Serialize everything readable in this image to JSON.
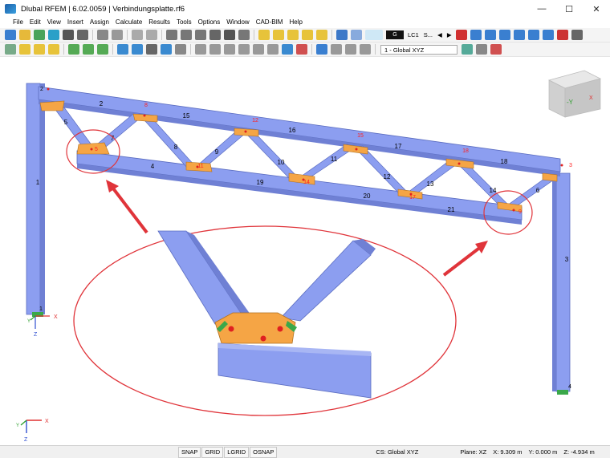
{
  "window": {
    "title": "Dlubal RFEM | 6.02.0059 | Verbindungsplatte.rf6",
    "minimize_symbol": "—",
    "maximize_symbol": "☐",
    "close_symbol": "✕"
  },
  "menu": [
    "File",
    "Edit",
    "View",
    "Insert",
    "Assign",
    "Calculate",
    "Results",
    "Tools",
    "Options",
    "Window",
    "CAD-BIM",
    "Help"
  ],
  "toolbar": {
    "lc_g": "G",
    "lc_label": "LC1",
    "lc_sub": "S...",
    "cs_combo": "1 - Global XYZ"
  },
  "model": {
    "members": {
      "m1": "1",
      "m2": "2",
      "m3": "3",
      "m4": "4",
      "m5": "5",
      "m6": "6",
      "m7": "7",
      "m8": "8",
      "m9": "9",
      "m10": "10",
      "m11": "11",
      "m12": "12",
      "m13": "13",
      "m14": "14",
      "m15": "15",
      "m16": "16",
      "m17": "17",
      "m18": "18",
      "m19": "19",
      "m20": "20",
      "m21": "21"
    },
    "plates": {
      "p3": "3",
      "p5": "5",
      "p8": "8",
      "p11": "11",
      "p12": "12",
      "p14": "14",
      "p15": "15",
      "p17": "17",
      "p18": "18",
      "p9": "9"
    },
    "nodes": {
      "n1": "1",
      "n2": "2",
      "n4": "4",
      "n3": "3"
    },
    "axes": {
      "x": "X",
      "y": "Y",
      "z": "Z"
    },
    "nav_cube_face": "-Y"
  },
  "statusbar": {
    "snap": "SNAP",
    "grid": "GRID",
    "lgrid": "LGRID",
    "osnap": "OSNAP",
    "cs": "CS: Global XYZ",
    "plane": "Plane: XZ",
    "x": "X: 9.309 m",
    "y": "Y: 0.000 m",
    "z": "Z: -4.934 m"
  },
  "colors": {
    "member": "#8c9ef0",
    "member_dark": "#6e80d8",
    "plate": "#f5a545",
    "member_label": "#000000",
    "plate_label": "#ff0000",
    "callout": "#e0343a"
  }
}
